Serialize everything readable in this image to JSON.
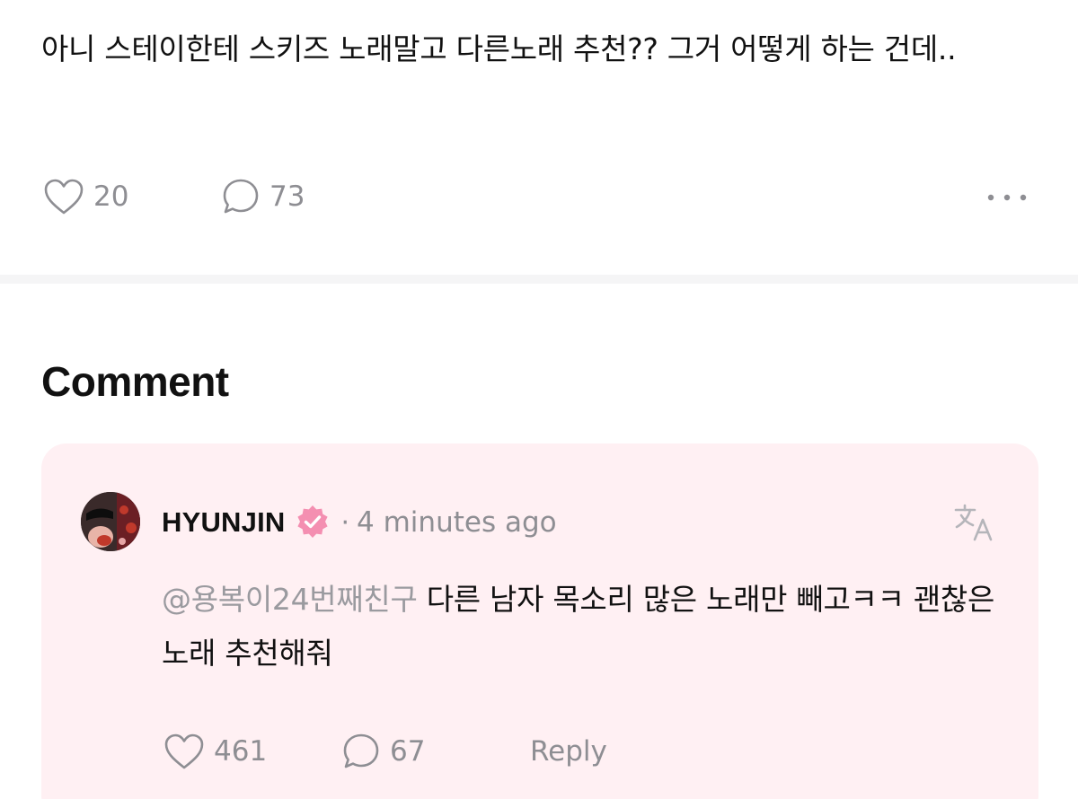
{
  "post": {
    "text": "아니 스테이한테 스키즈 노래말고 다른노래 추천?? 그거 어떻게 하는 건데..",
    "like_count": "20",
    "comment_count": "73",
    "icons": {
      "like": "heart-icon",
      "comment": "speech-bubble-icon",
      "more": "more-horizontal-icon"
    }
  },
  "comments_section": {
    "heading": "Comment",
    "comments": [
      {
        "author": "HYUNJIN",
        "verified": true,
        "separator": "·",
        "timestamp": "4 minutes ago",
        "mention": "@용복이24번째친구",
        "text": "다른 남자 목소리 많은 노래만 빼고ㅋㅋ 괜찮은 노래 추천해줘",
        "like_count": "461",
        "reply_count": "67",
        "reply_label": "Reply",
        "icons": {
          "avatar": "avatar-photo",
          "badge": "verified-badge-icon",
          "translate": "translate-icon",
          "like": "heart-icon",
          "comment": "speech-bubble-icon"
        }
      }
    ]
  },
  "colors": {
    "text_primary": "#111111",
    "text_secondary": "#8e8e93",
    "mention": "#9a9a9f",
    "card_background": "#fff0f3",
    "badge_pink": "#f48fb1",
    "divider": "#f5f5f6"
  }
}
